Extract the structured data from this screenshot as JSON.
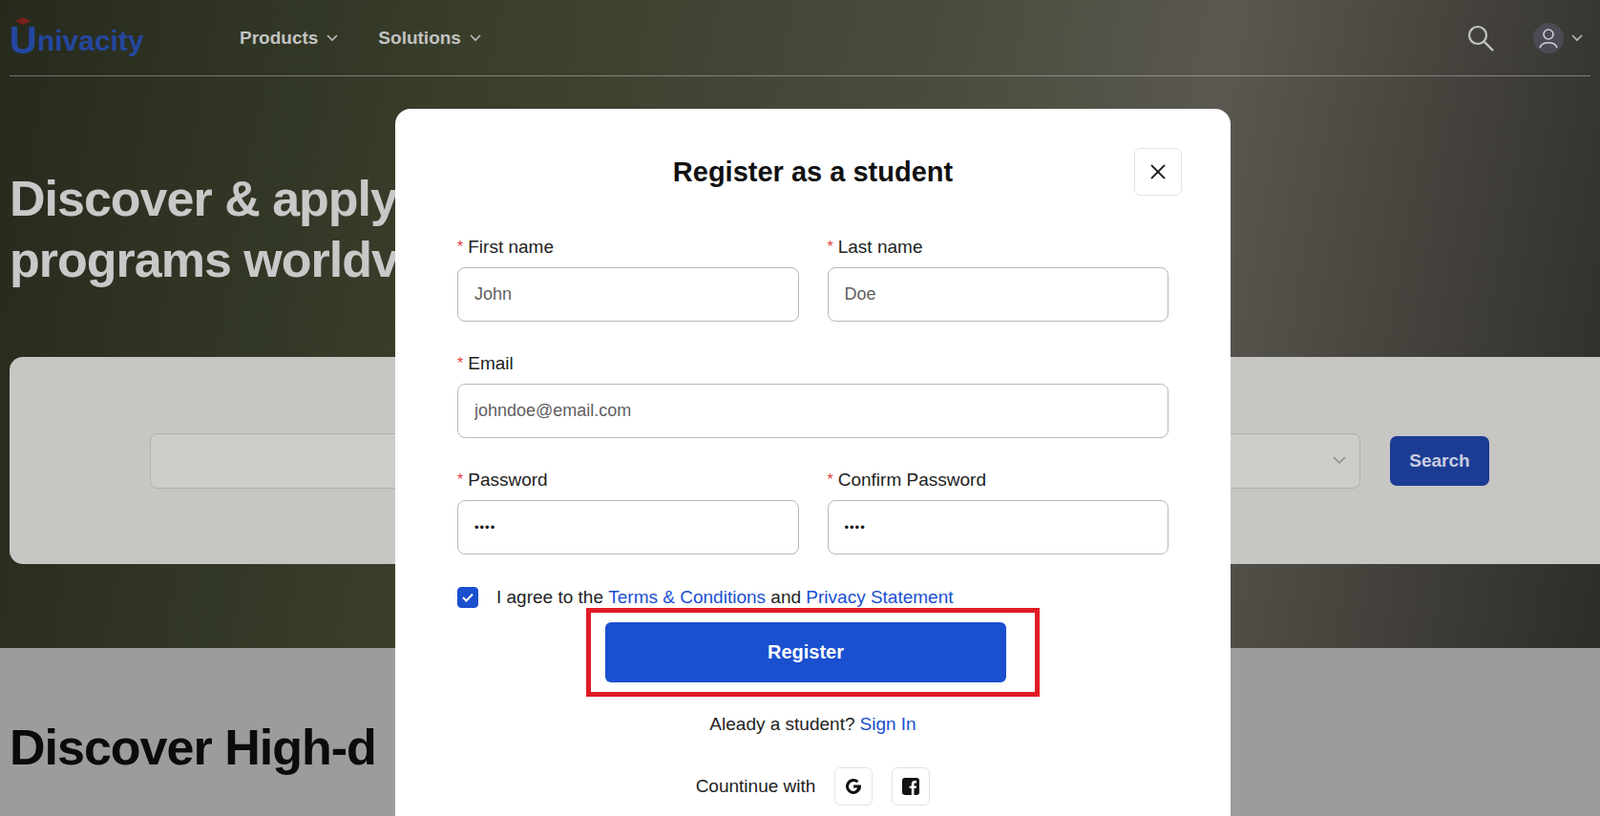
{
  "header": {
    "logo": {
      "letter": "U",
      "rest": "nivacity"
    },
    "nav": [
      {
        "label": "Products"
      },
      {
        "label": "Solutions"
      }
    ]
  },
  "hero": {
    "lines": [
      "Discover & apply",
      "programs worldv"
    ]
  },
  "search": {
    "button": "Search"
  },
  "section": {
    "title": "Discover High-d"
  },
  "modal": {
    "title": "Register as a student",
    "rows": [
      [
        {
          "label": "First name",
          "mark": "*",
          "placeholder": "John"
        },
        {
          "label": "Last name",
          "mark": "*",
          "placeholder": "Doe"
        }
      ],
      [
        {
          "label": "Email",
          "mark": "*",
          "placeholder": "johndoe@email.com"
        }
      ],
      [
        {
          "label": "Password",
          "mark": "*",
          "value": "••••"
        },
        {
          "label": "Confirm Password",
          "mark": "*",
          "value": "••••"
        }
      ]
    ],
    "consent": {
      "checked": true,
      "parts": [
        {
          "text": "I agree to the",
          "link": false
        },
        {
          "text": "Terms & Conditions",
          "link": true
        },
        {
          "text": "and",
          "link": false
        },
        {
          "text": "Privacy Statement",
          "link": true
        }
      ]
    },
    "register": {
      "label": "Register",
      "highlighted": true
    },
    "signin": {
      "prompt": "Aleady a student?",
      "link": "Sign In"
    },
    "social": {
      "label": "Countinue with"
    }
  }
}
